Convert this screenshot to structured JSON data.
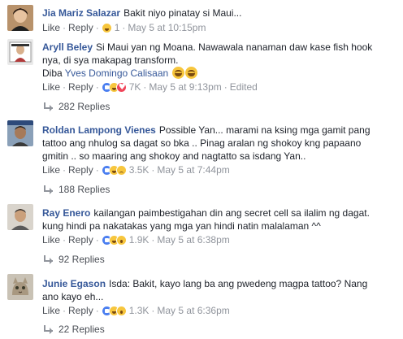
{
  "actions": {
    "like": "Like",
    "reply": "Reply",
    "sep": "·"
  },
  "colors": {
    "name": "#365899",
    "meta": "#90949c",
    "like_blue": "#4a7ef0"
  },
  "comments": [
    {
      "author": "Jia Mariz Salazar",
      "lines": [
        "Bakit niyo pinatay si Maui..."
      ],
      "reactions": [
        "haha"
      ],
      "reaction_count": "1",
      "timestamp": "May 5 at 10:15pm",
      "edited": "",
      "replies": ""
    },
    {
      "author": "Aryll Beley",
      "lines": [
        "Si Maui yan ng Moana. Nawawala nanaman daw kase fish hook",
        "nya, di sya makapag transform."
      ],
      "line3_prefix": "Diba ",
      "line3_link": "Yves Domingo Calisaan",
      "reactions": [
        "like",
        "haha",
        "love"
      ],
      "reaction_count": "7K",
      "timestamp": "May 5 at 9:13pm",
      "edited": "Edited",
      "replies": "282 Replies"
    },
    {
      "author": "Roldan Lampong Vienes",
      "lines": [
        "Possible Yan... marami na ksing mga gamit pang",
        "tattoo ang nhulog sa dagat so bka .. Pinag aralan ng shokoy kng papaano",
        "gmitin .. so maaring ang shokoy and nagtatto sa isdang Yan.."
      ],
      "reactions": [
        "like",
        "haha",
        "sad"
      ],
      "reaction_count": "3.5K",
      "timestamp": "May 5 at 7:44pm",
      "edited": "",
      "replies": "188 Replies"
    },
    {
      "author": "Ray Enero",
      "lines": [
        "kailangan paimbestigahan din ang secret cell sa ilalim ng dagat.",
        "kung hindi pa nakatakas yang mga yan hindi natin malalaman ^^"
      ],
      "reactions": [
        "like",
        "haha",
        "wow"
      ],
      "reaction_count": "1.9K",
      "timestamp": "May 5 at 6:38pm",
      "edited": "",
      "replies": "92 Replies"
    },
    {
      "author": "Junie Egason",
      "lines": [
        "Isda: Bakit, kayo lang ba ang pwedeng magpa tattoo? Nang",
        "ano kayo eh..."
      ],
      "reactions": [
        "like",
        "haha",
        "wow"
      ],
      "reaction_count": "1.3K",
      "timestamp": "May 5 at 6:36pm",
      "edited": "",
      "replies": "22 Replies"
    }
  ]
}
